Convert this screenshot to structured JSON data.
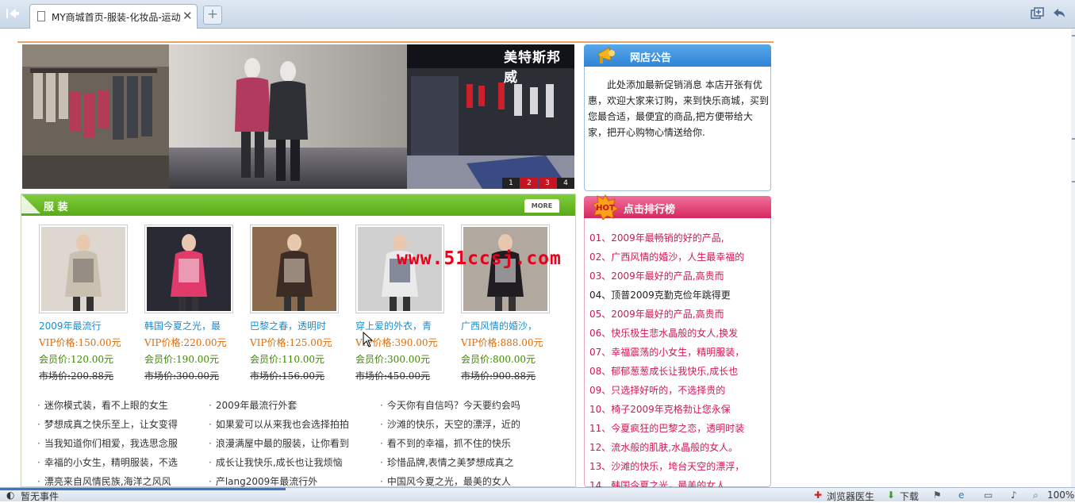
{
  "browser": {
    "tab_title": "MY商城首页-服装-化妆品-运动",
    "close_glyph": "✕",
    "newtab_glyph": "+",
    "status_text": "暂无事件",
    "status_items": [
      "浏览器医生",
      "下载"
    ],
    "zoom": "100%"
  },
  "banner": {
    "shop_name": "美特斯邦威",
    "slides": [
      "1",
      "2",
      "3",
      "4"
    ],
    "active_slides": [
      1,
      2
    ]
  },
  "section": {
    "title": "服 装",
    "more_label": "MORE"
  },
  "products": [
    {
      "name": "2009年最流行",
      "vip": "VIP价格:150.00元",
      "member": "会员价:120.00元",
      "market": "市场价:200.88元"
    },
    {
      "name": "韩国今夏之光，最",
      "vip": "VIP价格:220.00元",
      "member": "会员价:190.00元",
      "market": "市场价:300.00元"
    },
    {
      "name": "巴黎之春，透明时",
      "vip": "VIP价格:125.00元",
      "member": "会员价:110.00元",
      "market": "市场价:156.00元"
    },
    {
      "name": "穿上爱的外衣，青",
      "vip": "VIP价格:390.00元",
      "member": "会员价:300.00元",
      "market": "市场价:450.00元"
    },
    {
      "name": "广西风情的婚沙，",
      "vip": "VIP价格:888.00元",
      "member": "会员价:800.00元",
      "market": "市场价:900.88元"
    }
  ],
  "news_columns": [
    [
      "迷你模式装，看不上眼的女生",
      "梦想成真之快乐至上，让女变得",
      "当我知道你们相爱，我选思念服",
      "幸福的小女生，精明服装，不选",
      "漂亮来自风情民族,海洋之风风"
    ],
    [
      "2009年最流行外套",
      "如果爱可以从来我也会选择拍拍",
      "浪漫满屋中最的服装，让你看到",
      "成长让我快乐,成长也让我烦恼",
      "产lang2009年最流行外"
    ],
    [
      "今天你有自信吗？今天要约会吗",
      "沙滩的快乐，天空的漂浮，近的",
      "看不到的幸福，抓不住的快乐",
      "珍惜品牌,表情之美梦想成真之",
      "中国风今夏之光，最美的女人"
    ]
  ],
  "notice": {
    "title": "网店公告",
    "text": "此处添加最新促销消息 本店开张有优惠，欢迎大家来订购，来到快乐商城，买到您最合适，最便宜的商品,把方便带给大家，把开心购物心情送给你."
  },
  "ranking": {
    "title": "点击排行榜",
    "badge": "HOT",
    "items": [
      "01、2009年最畅销的好的产品,",
      "02、广西风情的婚沙，人生最幸福的",
      "03、2009年最好的产品,高贵而",
      "04、顶普2009克勤克俭年跳得更",
      "05、2009年最好的产品,高贵而",
      "06、快乐极生悲水晶般的女人,换发",
      "07、幸福震荡的小女生，精明服装，",
      "08、郁郁葱葱成长让我快乐,成长也",
      "09、只选择好听的，不选择贵的",
      "10、椅子2009年克格勃让您永保",
      "11、今夏疯狂的巴黎之恋，透明时装",
      "12、流水般的肌肤,水晶般的女人。",
      "13、沙滩的快乐，垮台天空的漂浮，",
      "14、韩国今夏之光，最美的女人"
    ],
    "dark_items": [
      3
    ]
  },
  "watermark": "www.51ccsj.com",
  "colors": {
    "section_green": "#5fb31d",
    "notice_blue": "#2e84d6",
    "ranking_pink": "#e0386c",
    "price_orange": "#e56a00",
    "member_green": "#3c8a00",
    "link_blue": "#1b8fd0",
    "rank_red": "#d0184f",
    "watermark_red": "#e8001a"
  }
}
